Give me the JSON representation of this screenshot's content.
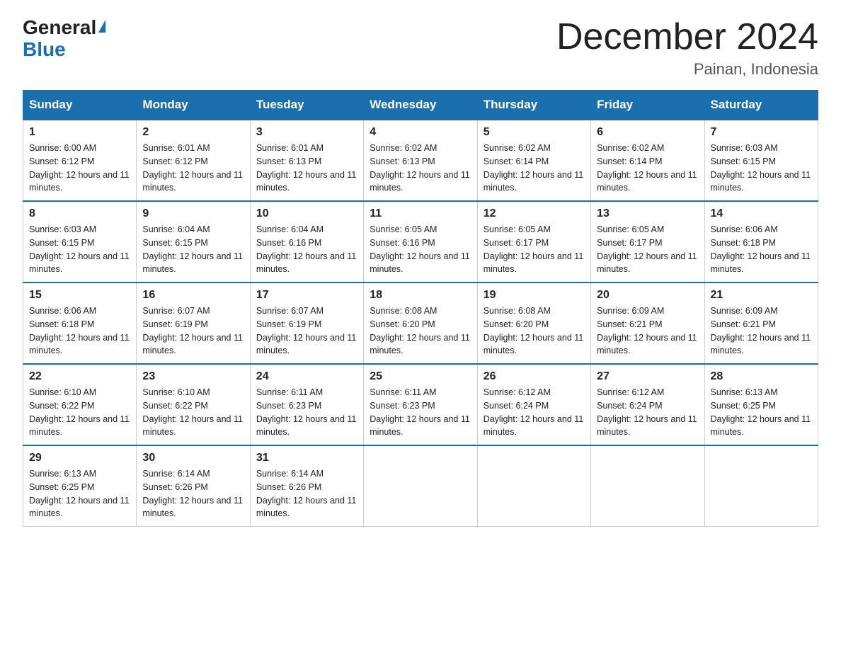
{
  "logo": {
    "general": "General",
    "blue": "Blue"
  },
  "header": {
    "month_title": "December 2024",
    "location": "Painan, Indonesia"
  },
  "weekdays": [
    "Sunday",
    "Monday",
    "Tuesday",
    "Wednesday",
    "Thursday",
    "Friday",
    "Saturday"
  ],
  "weeks": [
    [
      {
        "day": "1",
        "sunrise": "6:00 AM",
        "sunset": "6:12 PM",
        "daylight": "12 hours and 11 minutes."
      },
      {
        "day": "2",
        "sunrise": "6:01 AM",
        "sunset": "6:12 PM",
        "daylight": "12 hours and 11 minutes."
      },
      {
        "day": "3",
        "sunrise": "6:01 AM",
        "sunset": "6:13 PM",
        "daylight": "12 hours and 11 minutes."
      },
      {
        "day": "4",
        "sunrise": "6:02 AM",
        "sunset": "6:13 PM",
        "daylight": "12 hours and 11 minutes."
      },
      {
        "day": "5",
        "sunrise": "6:02 AM",
        "sunset": "6:14 PM",
        "daylight": "12 hours and 11 minutes."
      },
      {
        "day": "6",
        "sunrise": "6:02 AM",
        "sunset": "6:14 PM",
        "daylight": "12 hours and 11 minutes."
      },
      {
        "day": "7",
        "sunrise": "6:03 AM",
        "sunset": "6:15 PM",
        "daylight": "12 hours and 11 minutes."
      }
    ],
    [
      {
        "day": "8",
        "sunrise": "6:03 AM",
        "sunset": "6:15 PM",
        "daylight": "12 hours and 11 minutes."
      },
      {
        "day": "9",
        "sunrise": "6:04 AM",
        "sunset": "6:15 PM",
        "daylight": "12 hours and 11 minutes."
      },
      {
        "day": "10",
        "sunrise": "6:04 AM",
        "sunset": "6:16 PM",
        "daylight": "12 hours and 11 minutes."
      },
      {
        "day": "11",
        "sunrise": "6:05 AM",
        "sunset": "6:16 PM",
        "daylight": "12 hours and 11 minutes."
      },
      {
        "day": "12",
        "sunrise": "6:05 AM",
        "sunset": "6:17 PM",
        "daylight": "12 hours and 11 minutes."
      },
      {
        "day": "13",
        "sunrise": "6:05 AM",
        "sunset": "6:17 PM",
        "daylight": "12 hours and 11 minutes."
      },
      {
        "day": "14",
        "sunrise": "6:06 AM",
        "sunset": "6:18 PM",
        "daylight": "12 hours and 11 minutes."
      }
    ],
    [
      {
        "day": "15",
        "sunrise": "6:06 AM",
        "sunset": "6:18 PM",
        "daylight": "12 hours and 11 minutes."
      },
      {
        "day": "16",
        "sunrise": "6:07 AM",
        "sunset": "6:19 PM",
        "daylight": "12 hours and 11 minutes."
      },
      {
        "day": "17",
        "sunrise": "6:07 AM",
        "sunset": "6:19 PM",
        "daylight": "12 hours and 11 minutes."
      },
      {
        "day": "18",
        "sunrise": "6:08 AM",
        "sunset": "6:20 PM",
        "daylight": "12 hours and 11 minutes."
      },
      {
        "day": "19",
        "sunrise": "6:08 AM",
        "sunset": "6:20 PM",
        "daylight": "12 hours and 11 minutes."
      },
      {
        "day": "20",
        "sunrise": "6:09 AM",
        "sunset": "6:21 PM",
        "daylight": "12 hours and 11 minutes."
      },
      {
        "day": "21",
        "sunrise": "6:09 AM",
        "sunset": "6:21 PM",
        "daylight": "12 hours and 11 minutes."
      }
    ],
    [
      {
        "day": "22",
        "sunrise": "6:10 AM",
        "sunset": "6:22 PM",
        "daylight": "12 hours and 11 minutes."
      },
      {
        "day": "23",
        "sunrise": "6:10 AM",
        "sunset": "6:22 PM",
        "daylight": "12 hours and 11 minutes."
      },
      {
        "day": "24",
        "sunrise": "6:11 AM",
        "sunset": "6:23 PM",
        "daylight": "12 hours and 11 minutes."
      },
      {
        "day": "25",
        "sunrise": "6:11 AM",
        "sunset": "6:23 PM",
        "daylight": "12 hours and 11 minutes."
      },
      {
        "day": "26",
        "sunrise": "6:12 AM",
        "sunset": "6:24 PM",
        "daylight": "12 hours and 11 minutes."
      },
      {
        "day": "27",
        "sunrise": "6:12 AM",
        "sunset": "6:24 PM",
        "daylight": "12 hours and 11 minutes."
      },
      {
        "day": "28",
        "sunrise": "6:13 AM",
        "sunset": "6:25 PM",
        "daylight": "12 hours and 11 minutes."
      }
    ],
    [
      {
        "day": "29",
        "sunrise": "6:13 AM",
        "sunset": "6:25 PM",
        "daylight": "12 hours and 11 minutes."
      },
      {
        "day": "30",
        "sunrise": "6:14 AM",
        "sunset": "6:26 PM",
        "daylight": "12 hours and 11 minutes."
      },
      {
        "day": "31",
        "sunrise": "6:14 AM",
        "sunset": "6:26 PM",
        "daylight": "12 hours and 11 minutes."
      },
      null,
      null,
      null,
      null
    ]
  ]
}
